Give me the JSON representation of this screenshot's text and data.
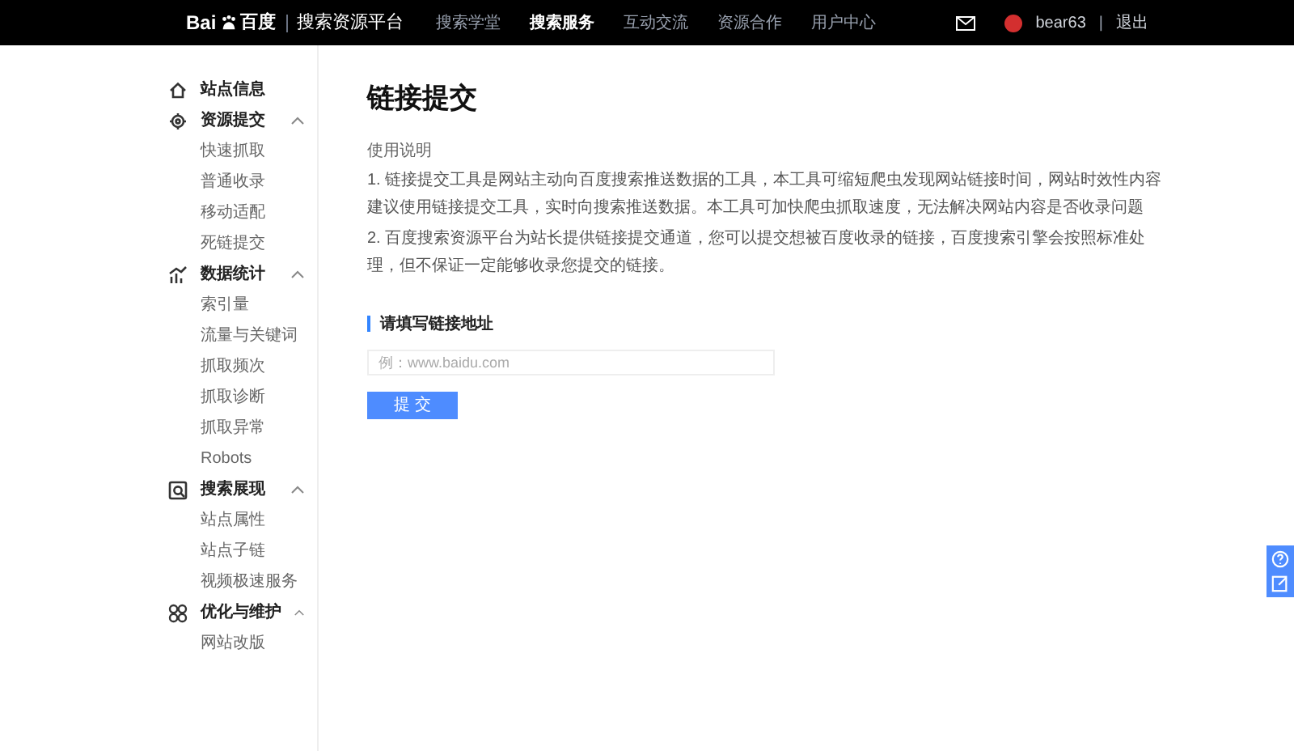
{
  "header": {
    "logo_left": "Bai",
    "logo_right": "百度",
    "platform": "搜索资源平台",
    "nav": [
      {
        "label": "搜索学堂",
        "selected": false
      },
      {
        "label": "搜索服务",
        "selected": true
      },
      {
        "label": "互动交流",
        "selected": false
      },
      {
        "label": "资源合作",
        "selected": false
      },
      {
        "label": "用户中心",
        "selected": false
      }
    ],
    "username": "bear63",
    "separator": "|",
    "logout": "退出"
  },
  "sidebar": [
    {
      "label": "站点信息"
    },
    {
      "label": "资源提交",
      "expanded": true,
      "children": [
        {
          "label": "快速抓取"
        },
        {
          "label": "普通收录"
        },
        {
          "label": "移动适配"
        },
        {
          "label": "死链提交"
        }
      ]
    },
    {
      "label": "数据统计",
      "expanded": true,
      "children": [
        {
          "label": "索引量"
        },
        {
          "label": "流量与关键词"
        },
        {
          "label": "抓取频次"
        },
        {
          "label": "抓取诊断"
        },
        {
          "label": "抓取异常"
        },
        {
          "label": "Robots"
        }
      ]
    },
    {
      "label": "搜索展现",
      "expanded": true,
      "children": [
        {
          "label": "站点属性"
        },
        {
          "label": "站点子链"
        },
        {
          "label": "视频极速服务"
        }
      ]
    },
    {
      "label": "优化与维护",
      "expanded": true,
      "children": [
        {
          "label": "网站改版"
        }
      ]
    }
  ],
  "main": {
    "title": "链接提交",
    "usage_heading": "使用说明",
    "instructions": [
      "1. 链接提交工具是网站主动向百度搜索推送数据的工具，本工具可缩短爬虫发现网站链接时间，网站时效性内容建议使用链接提交工具，实时向搜索推送数据。本工具可加快爬虫抓取速度，无法解决网站内容是否收录问题",
      "2. 百度搜索资源平台为站长提供链接提交通道，您可以提交想被百度收录的链接，百度搜索引擎会按照标准处理，但不保证一定能够收录您提交的链接。"
    ],
    "field_label": "请填写链接地址",
    "field_placeholder": "例：www.baidu.com",
    "submit": "提 交"
  }
}
